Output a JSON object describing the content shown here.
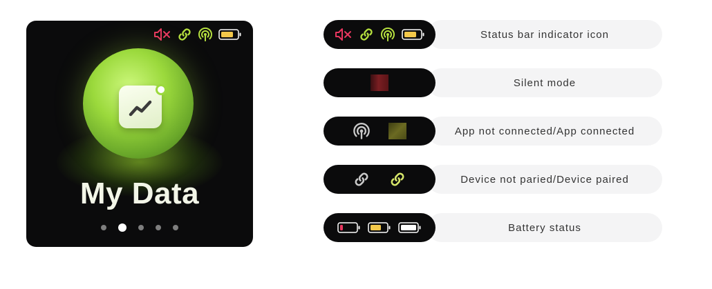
{
  "screen": {
    "title": "My Data",
    "page_count": 5,
    "active_page": 2,
    "status_icons": [
      "mute-icon",
      "link-icon",
      "broadcast-icon",
      "battery-icon"
    ]
  },
  "legend": {
    "rows": [
      {
        "label": "Status bar indicator icon",
        "icons": [
          "mute-icon",
          "link-icon",
          "broadcast-icon",
          "battery-icon"
        ]
      },
      {
        "label": "Silent mode",
        "icons": [
          "silent-mode-swatch"
        ]
      },
      {
        "label": "App not connected/App connected",
        "icons": [
          "broadcast-icon-grey",
          "connected-swatch"
        ]
      },
      {
        "label": "Device not paried/Device paired",
        "icons": [
          "link-icon-grey",
          "link-icon-lime"
        ]
      },
      {
        "label": "Battery status",
        "icons": [
          "battery-low-icon",
          "battery-medium-icon",
          "battery-full-icon"
        ]
      }
    ]
  },
  "colors": {
    "mute": "#e8365f",
    "lime": "#b5df3f",
    "battery_mid": "#f3c84a",
    "battery_low": "#e8365f",
    "grey_icon": "#c9c9c9"
  }
}
